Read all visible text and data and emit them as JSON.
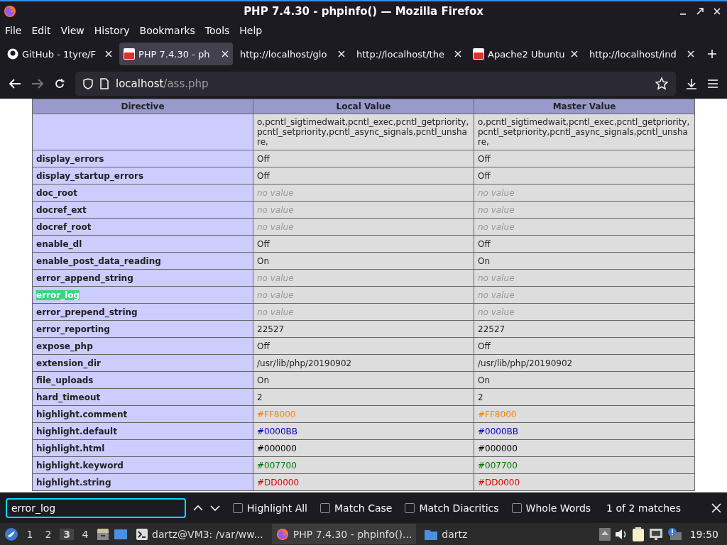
{
  "window": {
    "title": "PHP 7.4.30 - phpinfo() — Mozilla Firefox"
  },
  "menu": [
    "File",
    "Edit",
    "View",
    "History",
    "Bookmarks",
    "Tools",
    "Help"
  ],
  "tabs": [
    {
      "label": "GitHub - 1tyre/F",
      "kind": "github",
      "selected": false
    },
    {
      "label": "PHP 7.4.30 - ph",
      "kind": "retro",
      "selected": true
    },
    {
      "label": "http://localhost/glo",
      "kind": "plain",
      "selected": false
    },
    {
      "label": "http://localhost/the",
      "kind": "plain",
      "selected": false
    },
    {
      "label": "Apache2 Ubuntu",
      "kind": "retro",
      "selected": false
    },
    {
      "label": "http://localhost/ind",
      "kind": "plain",
      "selected": false
    }
  ],
  "address": {
    "host": "localhost",
    "path": "/ass.php"
  },
  "table": {
    "columns": [
      "Directive",
      "Local Value",
      "Master Value"
    ],
    "rows": [
      {
        "local": "o,pcntl_sigtimedwait,pcntl_exec,pcntl_getpriority,pcntl_setpriority,pcntl_async_signals,pcntl_unshare,",
        "master": "o,pcntl_sigtimedwait,pcntl_exec,pcntl_getpriority,pcntl_setpriority,pcntl_async_signals,pcntl_unshare,",
        "kind": "plain"
      },
      {
        "name": "display_errors",
        "local": "Off",
        "master": "Off",
        "kind": "plain",
        "match": false
      },
      {
        "name": "display_startup_errors",
        "local": "Off",
        "master": "Off",
        "kind": "plain",
        "match": false
      },
      {
        "name": "doc_root",
        "local": "no value",
        "master": "no value",
        "kind": "empty",
        "match": false
      },
      {
        "name": "docref_ext",
        "local": "no value",
        "master": "no value",
        "kind": "empty",
        "match": false
      },
      {
        "name": "docref_root",
        "local": "no value",
        "master": "no value",
        "kind": "empty",
        "match": false
      },
      {
        "name": "enable_dl",
        "local": "Off",
        "master": "Off",
        "kind": "plain",
        "match": false
      },
      {
        "name": "enable_post_data_reading",
        "local": "On",
        "master": "On",
        "kind": "plain",
        "match": false
      },
      {
        "name": "error_append_string",
        "local": "no value",
        "master": "no value",
        "kind": "empty",
        "match": false
      },
      {
        "name": "error_log",
        "local": "no value",
        "master": "no value",
        "kind": "empty",
        "match": true
      },
      {
        "name": "error_prepend_string",
        "local": "no value",
        "master": "no value",
        "kind": "empty",
        "match": false
      },
      {
        "name": "error_reporting",
        "local": "22527",
        "master": "22527",
        "kind": "plain",
        "match": false
      },
      {
        "name": "expose_php",
        "local": "Off",
        "master": "Off",
        "kind": "plain",
        "match": false
      },
      {
        "name": "extension_dir",
        "local": "/usr/lib/php/20190902",
        "master": "/usr/lib/php/20190902",
        "kind": "plain",
        "match": false
      },
      {
        "name": "file_uploads",
        "local": "On",
        "master": "On",
        "kind": "plain",
        "match": false
      },
      {
        "name": "hard_timeout",
        "local": "2",
        "master": "2",
        "kind": "plain",
        "match": false
      },
      {
        "name": "highlight.comment",
        "local": "#FF8000",
        "master": "#FF8000",
        "kind": "colored",
        "color": "#ff8000",
        "match": false
      },
      {
        "name": "highlight.default",
        "local": "#0000BB",
        "master": "#0000BB",
        "kind": "colored",
        "color": "#0000bb",
        "match": false
      },
      {
        "name": "highlight.html",
        "local": "#000000",
        "master": "#000000",
        "kind": "colored",
        "color": "#000000",
        "match": false
      },
      {
        "name": "highlight.keyword",
        "local": "#007700",
        "master": "#007700",
        "kind": "colored",
        "color": "#007700",
        "match": false
      },
      {
        "name": "highlight.string",
        "local": "#DD0000",
        "master": "#DD0000",
        "kind": "colored",
        "color": "#dd0000",
        "match": false
      }
    ]
  },
  "find": {
    "value": "error_log",
    "options": [
      {
        "label": "Highlight All",
        "checked": false
      },
      {
        "label": "Match Case",
        "checked": false
      },
      {
        "label": "Match Diacritics",
        "checked": false
      },
      {
        "label": "Whole Words",
        "checked": false
      }
    ],
    "status": "1 of 2 matches"
  },
  "taskbar": {
    "workspaces": [
      {
        "label": "1",
        "selected": false
      },
      {
        "label": "2",
        "selected": false
      },
      {
        "label": "3",
        "selected": true
      },
      {
        "label": "4",
        "selected": false
      }
    ],
    "tasks": [
      {
        "label": "dartz@VM3: /var/ww...",
        "kind": "terminal",
        "selected": false
      },
      {
        "label": "PHP 7.4.30 - phpinfo()...",
        "kind": "firefox",
        "selected": true
      },
      {
        "label": "dartz",
        "kind": "folder",
        "selected": false
      }
    ],
    "clock": "19:50"
  }
}
